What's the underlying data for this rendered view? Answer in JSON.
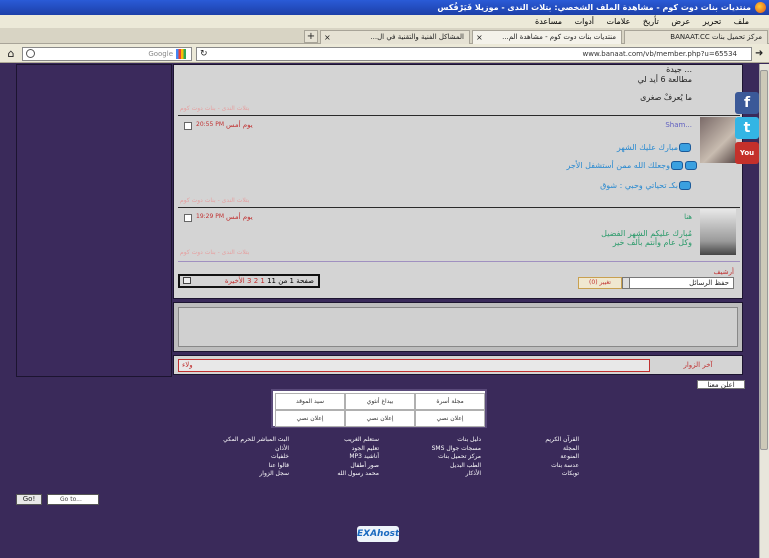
{
  "window": {
    "title": "منتديات بنات دوت كوم - مشاهدة الملف الشخصي: بتلات الندى - موزيلا فَيَرْفُكس",
    "menu": [
      "ملف",
      "تحرير",
      "عرض",
      "تأريخ",
      "علامات",
      "أدوات",
      "مساعدة"
    ]
  },
  "tabs": [
    {
      "label": "منتديات بنات دوت كوم - مشاهدة الم...",
      "active": true
    },
    {
      "label": "المشاكل الفنية والتقنية في ال...",
      "active": false
    },
    {
      "label": "مركز تحميل بنات BANAAT.CC",
      "active": false
    }
  ],
  "nav": {
    "search_placeholder": "Google",
    "url": "www.banaat.com/vb/member.php?u=65534"
  },
  "posts": [
    {
      "lines": [
        "... جيدة",
        "مطالعة 6 أيد لي",
        "ما يُعرفْ صغرى"
      ],
      "signature": "بتلات الندى - بنات دوت كوم"
    },
    {
      "author": "Sham...",
      "date": "يوم أمس",
      "time": "20:55 PM",
      "lines": [
        "مبارك عليك الشهر",
        "وجعلك الله ممن أستشفل الأجر",
        "بكـ تحياتي وحبي : شوق"
      ],
      "signature": "بتلات الندى - بنات دوت كوم"
    },
    {
      "author": "هنا",
      "date": "يوم أمس",
      "time": "19:29 PM",
      "lines": [
        "مُبارك عليكم الشهر الفضيل",
        "وكل عام وأنتم بألف خير"
      ],
      "signature": "بتلات الندى - بنات دوت كوم"
    }
  ],
  "pagination": {
    "label": "صفحة 1 من 11",
    "pages": [
      "1",
      "2",
      "3",
      "»",
      "الأخيرة"
    ]
  },
  "quick_reply": {
    "label": "أرشيف",
    "select": "حفظ الرسائل",
    "button": "(0) تغيير"
  },
  "last_visits": {
    "label": "آخر الزوار",
    "value": "ولاء"
  },
  "social": [
    "f",
    "t",
    "You"
  ],
  "ad_button": "اعلن معنا",
  "link_grid": [
    [
      "مجلة أسرة",
      "بيداغ أنثوي",
      "سيد الموقد"
    ],
    [
      "إعلان نصي",
      "إعلان نصي",
      "إعلان نصي"
    ]
  ],
  "footer": {
    "col1": [
      "القرآن الكريم",
      "المجلة",
      "المنوعة",
      "عدسة بنات",
      "توبكات"
    ],
    "col2": [
      "دليل بنات",
      "مسجات جوال SMS",
      "مركز تحميل بنات",
      "الطب البديل",
      "الأذكار"
    ],
    "col3": [
      "ستعلم الغريب",
      "تعليم الجود",
      "أناشيد MP3",
      "صور أطفال",
      "محمد رسول الله"
    ],
    "col4": [
      "البث المباشر للحرم المكي",
      "الأذان",
      "خلفيات",
      "قالوا عنا",
      "سجل الزوار"
    ]
  },
  "goto": {
    "button": "Go!",
    "select": "Go to..."
  },
  "logo": "EXAhost"
}
